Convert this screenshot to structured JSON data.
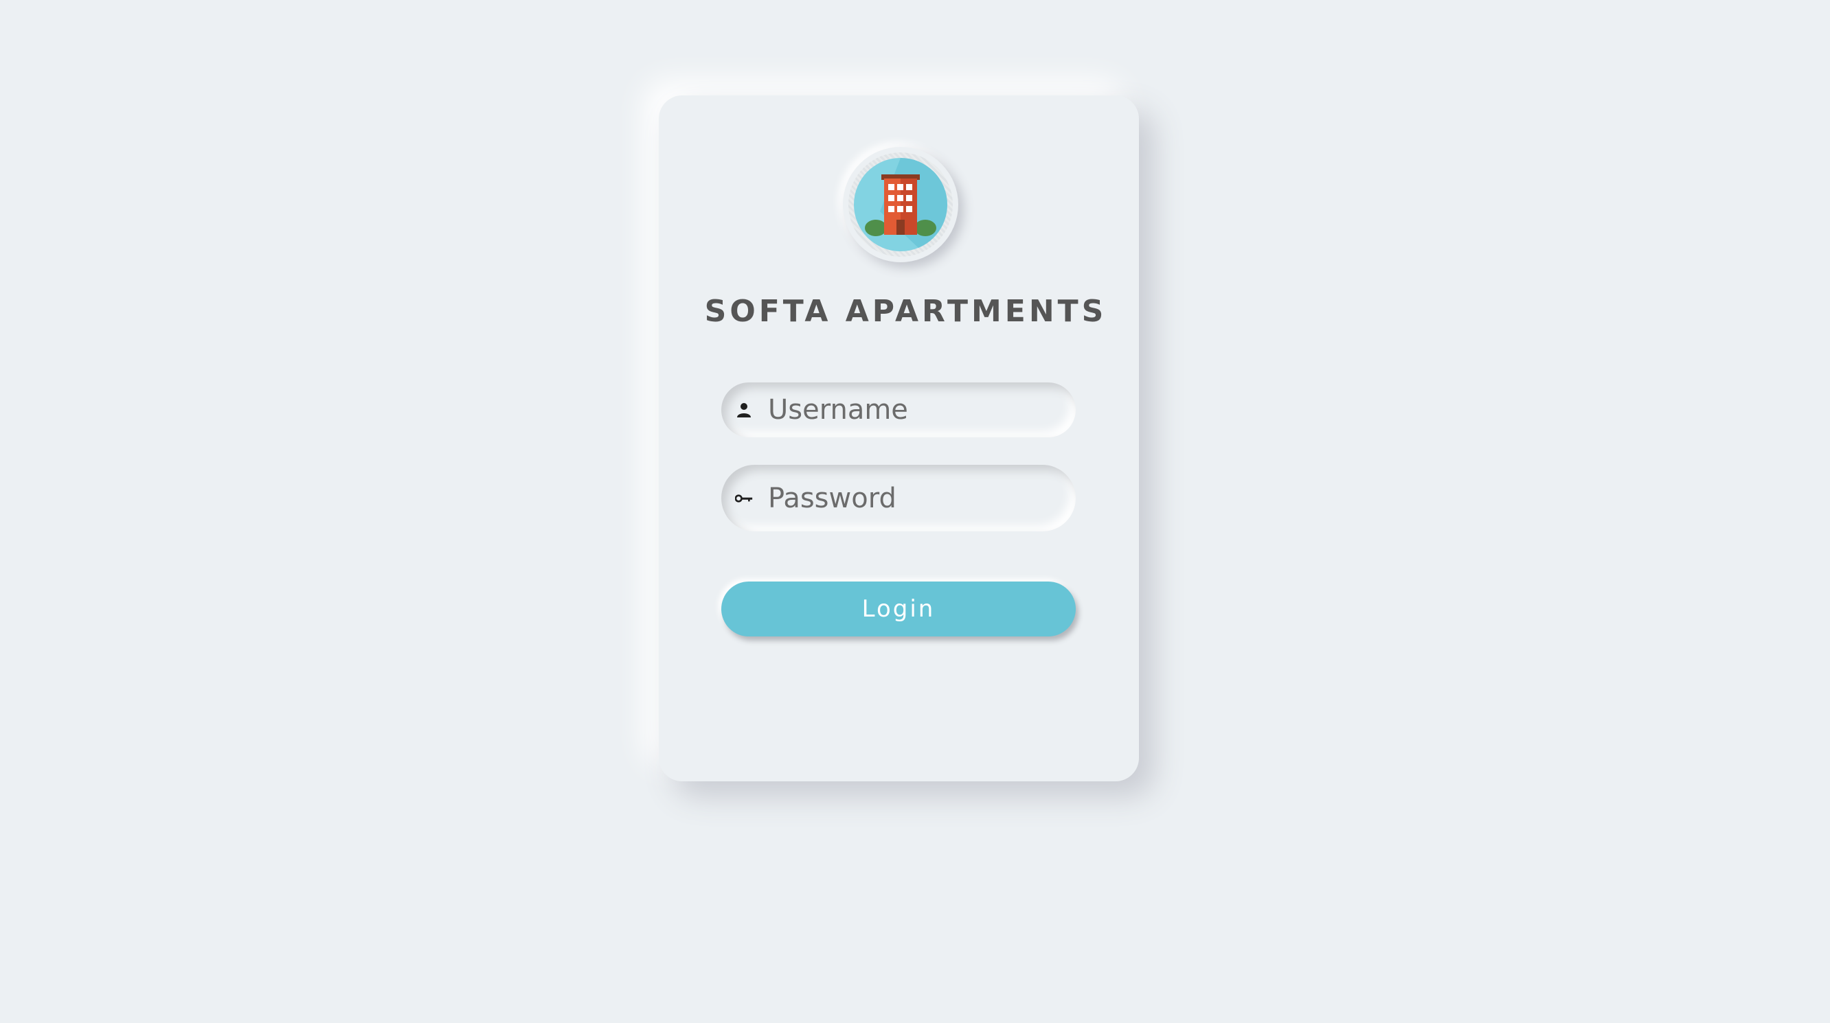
{
  "app": {
    "title": "SOFTA APARTMENTS",
    "logo_icon": "apartment-building-icon"
  },
  "form": {
    "username": {
      "placeholder": "Username",
      "value": "",
      "icon": "user-icon"
    },
    "password": {
      "placeholder": "Password",
      "value": "",
      "icon": "key-icon"
    },
    "login_label": "Login"
  },
  "colors": {
    "background": "#ecf0f3",
    "accent": "#67c4d6",
    "title_text": "#555555",
    "logo_circle": "#82d3e2",
    "building": "#e25b34"
  }
}
